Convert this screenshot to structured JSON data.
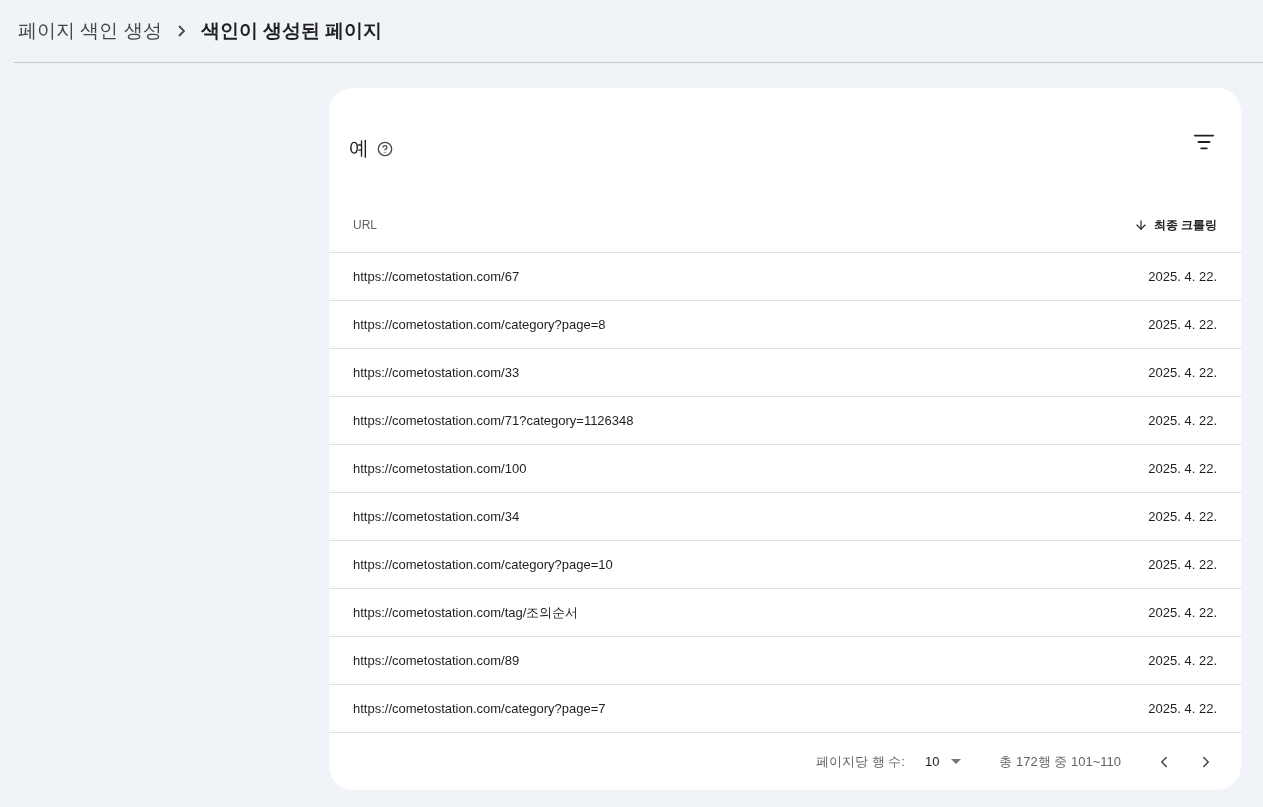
{
  "breadcrumb": [
    {
      "label": "페이지 색인 생성",
      "current": false
    },
    {
      "label": "색인이 생성된 페이지",
      "current": true
    }
  ],
  "card": {
    "title": "예",
    "table": {
      "columns": [
        {
          "label": "URL",
          "sorted": false
        },
        {
          "label": "최종 크롤링",
          "sorted": true
        }
      ],
      "rows": [
        {
          "url": "https://cometostation.com/67",
          "date": "2025. 4. 22."
        },
        {
          "url": "https://cometostation.com/category?page=8",
          "date": "2025. 4. 22."
        },
        {
          "url": "https://cometostation.com/33",
          "date": "2025. 4. 22."
        },
        {
          "url": "https://cometostation.com/71?category=1126348",
          "date": "2025. 4. 22."
        },
        {
          "url": "https://cometostation.com/100",
          "date": "2025. 4. 22."
        },
        {
          "url": "https://cometostation.com/34",
          "date": "2025. 4. 22."
        },
        {
          "url": "https://cometostation.com/category?page=10",
          "date": "2025. 4. 22."
        },
        {
          "url": "https://cometostation.com/tag/조의순서",
          "date": "2025. 4. 22."
        },
        {
          "url": "https://cometostation.com/89",
          "date": "2025. 4. 22."
        },
        {
          "url": "https://cometostation.com/category?page=7",
          "date": "2025. 4. 22."
        }
      ]
    },
    "pagination": {
      "rows_per_page_label": "페이지당 행 수:",
      "rows_per_page": "10",
      "range": "총 172행 중 101~110"
    }
  }
}
